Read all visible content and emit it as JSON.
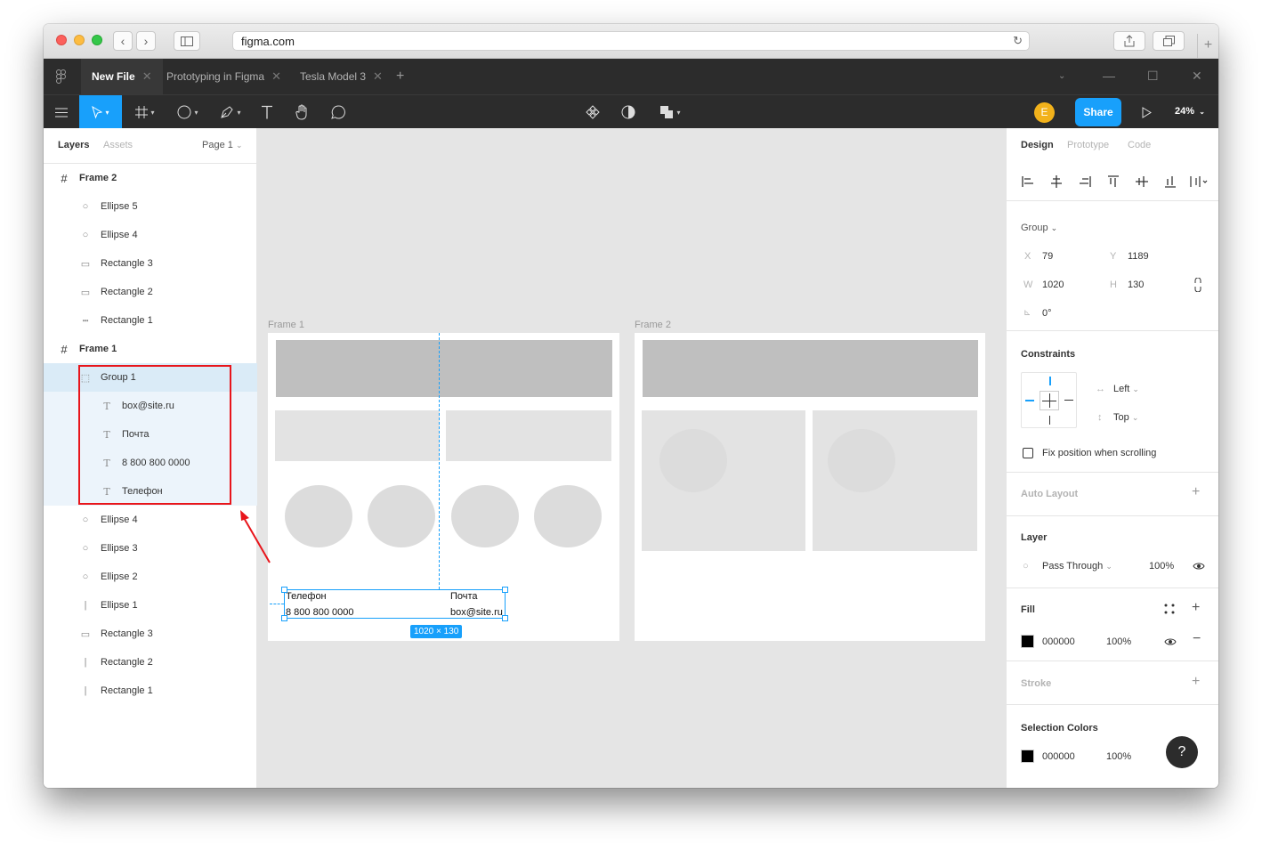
{
  "browser": {
    "url": "figma.com"
  },
  "tabs": [
    {
      "label": "New File",
      "active": true
    },
    {
      "label": "Prototyping in Figma",
      "active": false
    },
    {
      "label": "Tesla Model 3",
      "active": false
    }
  ],
  "toolbar": {
    "avatar_initial": "E",
    "share_label": "Share",
    "zoom": "24%"
  },
  "left_panel": {
    "tabs": [
      "Layers",
      "Assets"
    ],
    "page": "Page 1",
    "layers": [
      {
        "name": "Frame 2",
        "icon": "frame-icon"
      },
      {
        "name": "Ellipse 5",
        "icon": "ellipse-icon"
      },
      {
        "name": "Ellipse 4",
        "icon": "ellipse-icon"
      },
      {
        "name": "Rectangle 3",
        "icon": "rectangle-icon"
      },
      {
        "name": "Rectangle 2",
        "icon": "rectangle-icon"
      },
      {
        "name": "Rectangle 1",
        "icon": "line-icon"
      },
      {
        "name": "Frame 1",
        "icon": "frame-icon"
      },
      {
        "name": "Group 1",
        "icon": "group-icon"
      },
      {
        "name": "box@site.ru",
        "icon": "text-icon"
      },
      {
        "name": "Почта",
        "icon": "text-icon"
      },
      {
        "name": "8 800 800 0000",
        "icon": "text-icon"
      },
      {
        "name": "Телефон",
        "icon": "text-icon"
      },
      {
        "name": "Ellipse 4",
        "icon": "ellipse-icon"
      },
      {
        "name": "Ellipse 3",
        "icon": "ellipse-icon"
      },
      {
        "name": "Ellipse 2",
        "icon": "ellipse-icon"
      },
      {
        "name": "Ellipse 1",
        "icon": "vline-icon"
      },
      {
        "name": "Rectangle 3",
        "icon": "rectangle-icon"
      },
      {
        "name": "Rectangle 2",
        "icon": "vline-icon"
      },
      {
        "name": "Rectangle 1",
        "icon": "vline-icon"
      }
    ]
  },
  "canvas": {
    "frame1_label": "Frame 1",
    "frame2_label": "Frame 2",
    "group_text": {
      "phone_label": "Телефон",
      "phone_value": "8 800 800 0000",
      "mail_label": "Почта",
      "mail_value": "box@site.ru"
    },
    "selection_size": "1020 × 130"
  },
  "right_panel": {
    "tabs": [
      "Design",
      "Prototype",
      "Code"
    ],
    "group_label": "Group",
    "x_label": "X",
    "x": "79",
    "y_label": "Y",
    "y": "1189",
    "w_label": "W",
    "w": "1020",
    "h_label": "H",
    "h": "130",
    "rotation": "0°",
    "constraints_title": "Constraints",
    "constraint_h": "Left",
    "constraint_v": "Top",
    "fix_position": "Fix position when scrolling",
    "auto_layout_title": "Auto Layout",
    "layer_title": "Layer",
    "blend_mode": "Pass Through",
    "layer_opacity": "100%",
    "fill_title": "Fill",
    "fill_hex": "000000",
    "fill_opacity": "100%",
    "stroke_title": "Stroke",
    "selection_colors_title": "Selection Colors",
    "sel_color_hex": "000000",
    "sel_color_opacity": "100%",
    "help": "?"
  },
  "colors": {
    "accent": "#18a0fb",
    "toolbar_bg": "#2c2c2c",
    "annotation": "#e8151b",
    "avatar": "#f2b21b"
  }
}
